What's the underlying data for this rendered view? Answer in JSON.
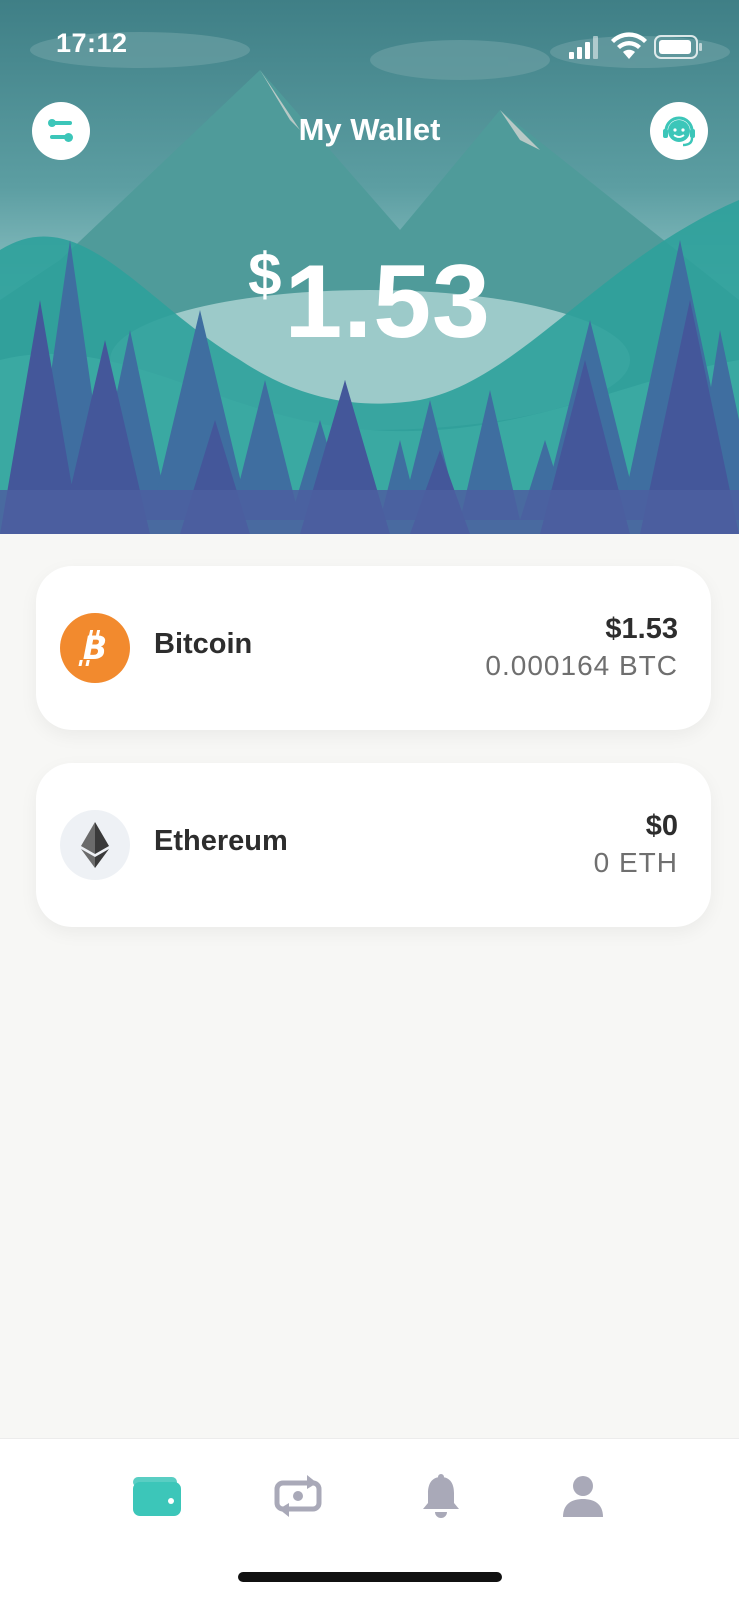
{
  "status_bar": {
    "time": "17:12"
  },
  "header": {
    "title": "My Wallet",
    "balance_currency": "$",
    "balance_amount": "1.53"
  },
  "icons": {
    "menu": "settings-toggle-icon",
    "support": "support-agent-icon"
  },
  "assets": [
    {
      "name": "Bitcoin",
      "fiat": "$1.53",
      "crypto": "0.000164 BTC",
      "icon": "bitcoin-icon",
      "color": "#f28a2e"
    },
    {
      "name": "Ethereum",
      "fiat": "$0",
      "crypto": "0 ETH",
      "icon": "ethereum-icon",
      "color": "#eef1f5"
    }
  ],
  "bottom_nav": [
    {
      "icon": "wallet-icon",
      "active": true
    },
    {
      "icon": "exchange-icon",
      "active": false
    },
    {
      "icon": "bell-icon",
      "active": false
    },
    {
      "icon": "profile-icon",
      "active": false
    }
  ],
  "colors": {
    "accent": "#3cc6b9",
    "inactive": "#a9a9b8",
    "bitcoin": "#f28a2e"
  }
}
